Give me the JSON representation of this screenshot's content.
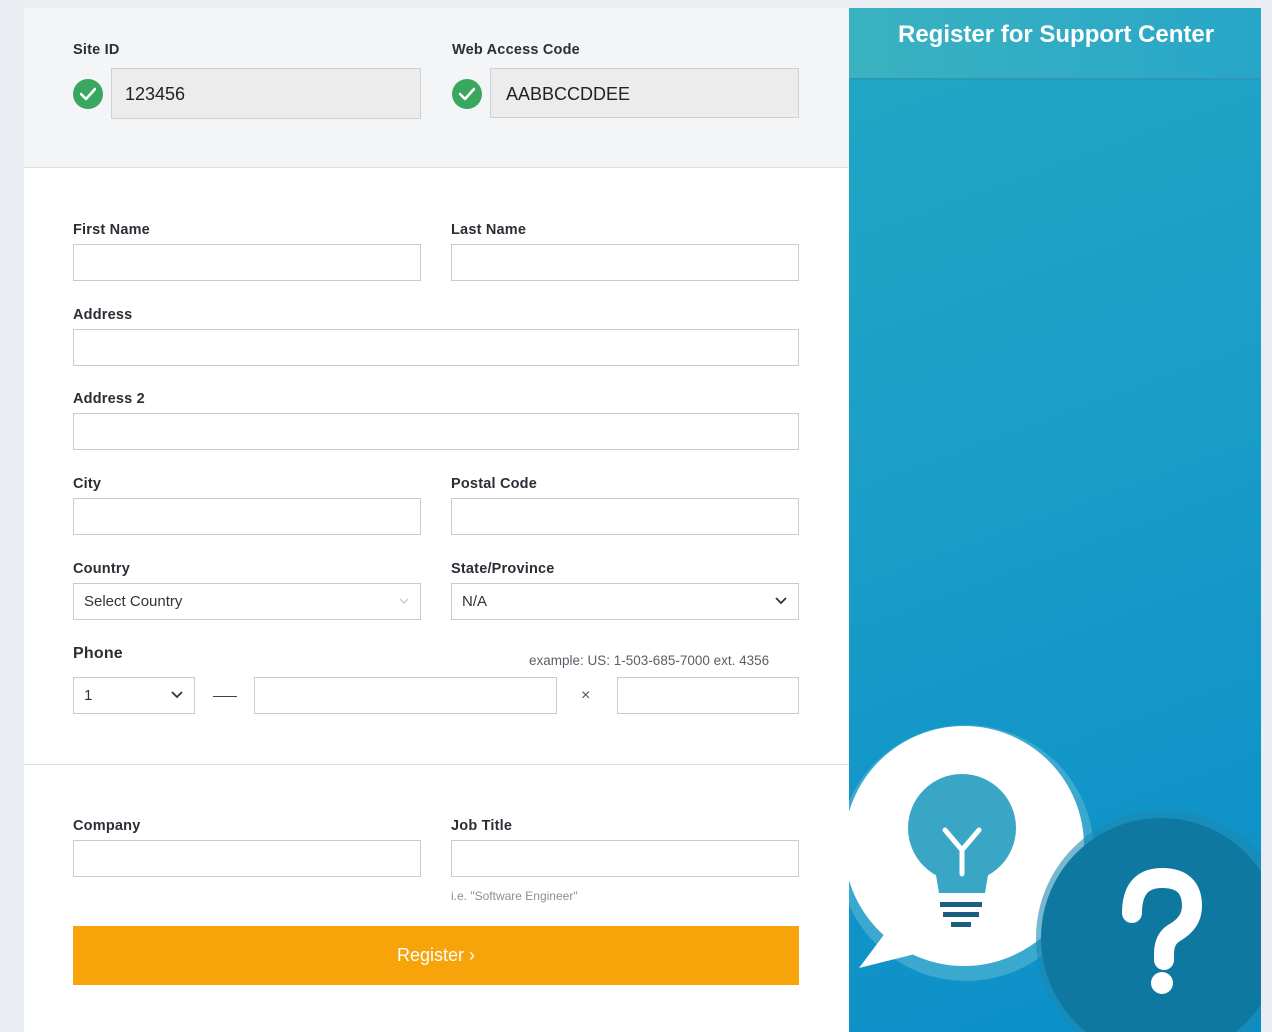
{
  "site": {
    "site_id_label": "Site ID",
    "site_id_value": "123456",
    "web_access_label": "Web Access Code",
    "web_access_value": "AABBCCDDEE"
  },
  "form": {
    "first_name_label": "First Name",
    "last_name_label": "Last Name",
    "address_label": "Address",
    "address2_label": "Address 2",
    "city_label": "City",
    "postal_label": "Postal Code",
    "country_label": "Country",
    "country_value": "Select Country",
    "state_label": "State/Province",
    "state_value": "N/A",
    "phone_label": "Phone",
    "phone_example": "example: US: 1-503-685-7000 ext. 4356",
    "phone_country_value": "1",
    "phone_ext_separator": "×",
    "company_label": "Company",
    "job_title_label": "Job Title",
    "job_title_hint": "i.e. \"Software Engineer\"",
    "register_label": "Register ›"
  },
  "side": {
    "title": "Register for Support Center"
  },
  "colors": {
    "accent_orange": "#f7a30a",
    "check_green": "#3aa75f",
    "side_blue": "#1b9ec8"
  },
  "icons": [
    "check-icon",
    "chevron-down-icon",
    "lightbulb-icon",
    "question-mark-icon"
  ]
}
